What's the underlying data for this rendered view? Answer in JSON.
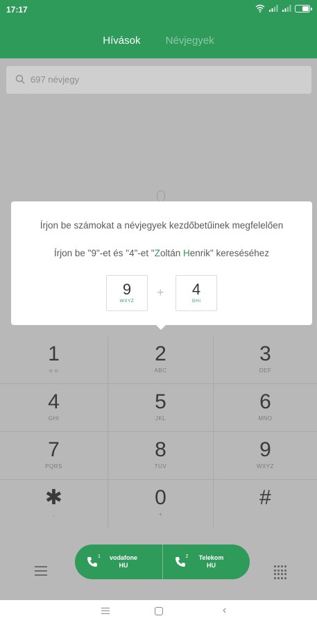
{
  "status_bar": {
    "time": "17:17"
  },
  "tabs": [
    {
      "label": "Hívások",
      "active": true
    },
    {
      "label": "Névjegyek",
      "active": false
    }
  ],
  "search": {
    "placeholder": "697 névjegy"
  },
  "tip": {
    "line1": "Írjon be számokat a névjegyek kezdőbetűinek megfelelően",
    "line2_prefix": "Írjon be \"9\"-et és \"4\"-et \"",
    "line2_z": "Z",
    "line2_mid1": "oltán ",
    "line2_h": "H",
    "line2_mid2": "enrik\" kereséséhez",
    "key1": {
      "digit": "9",
      "letters": "WXYZ"
    },
    "plus": "+",
    "key2": {
      "digit": "4",
      "letters": "GHI"
    }
  },
  "dialpad": [
    {
      "digit": "1",
      "sub": "ㅇㅇ"
    },
    {
      "digit": "2",
      "sub": "ABC"
    },
    {
      "digit": "3",
      "sub": "DEF"
    },
    {
      "digit": "4",
      "sub": "GHI"
    },
    {
      "digit": "5",
      "sub": "JKL"
    },
    {
      "digit": "6",
      "sub": "MNO"
    },
    {
      "digit": "7",
      "sub": "PQRS"
    },
    {
      "digit": "8",
      "sub": "TUV"
    },
    {
      "digit": "9",
      "sub": "WXYZ"
    },
    {
      "digit": "✱",
      "sub": ","
    },
    {
      "digit": "0",
      "sub": "+"
    },
    {
      "digit": "#",
      "sub": ""
    }
  ],
  "call": {
    "sim1": {
      "num": "1",
      "line1": "vodafone",
      "line2": "HU"
    },
    "sim2": {
      "num": "2",
      "line1": "Telekom",
      "line2": "HU"
    }
  },
  "colors": {
    "accent": "#2e9b5a",
    "overlay": "#b8b8b8"
  }
}
